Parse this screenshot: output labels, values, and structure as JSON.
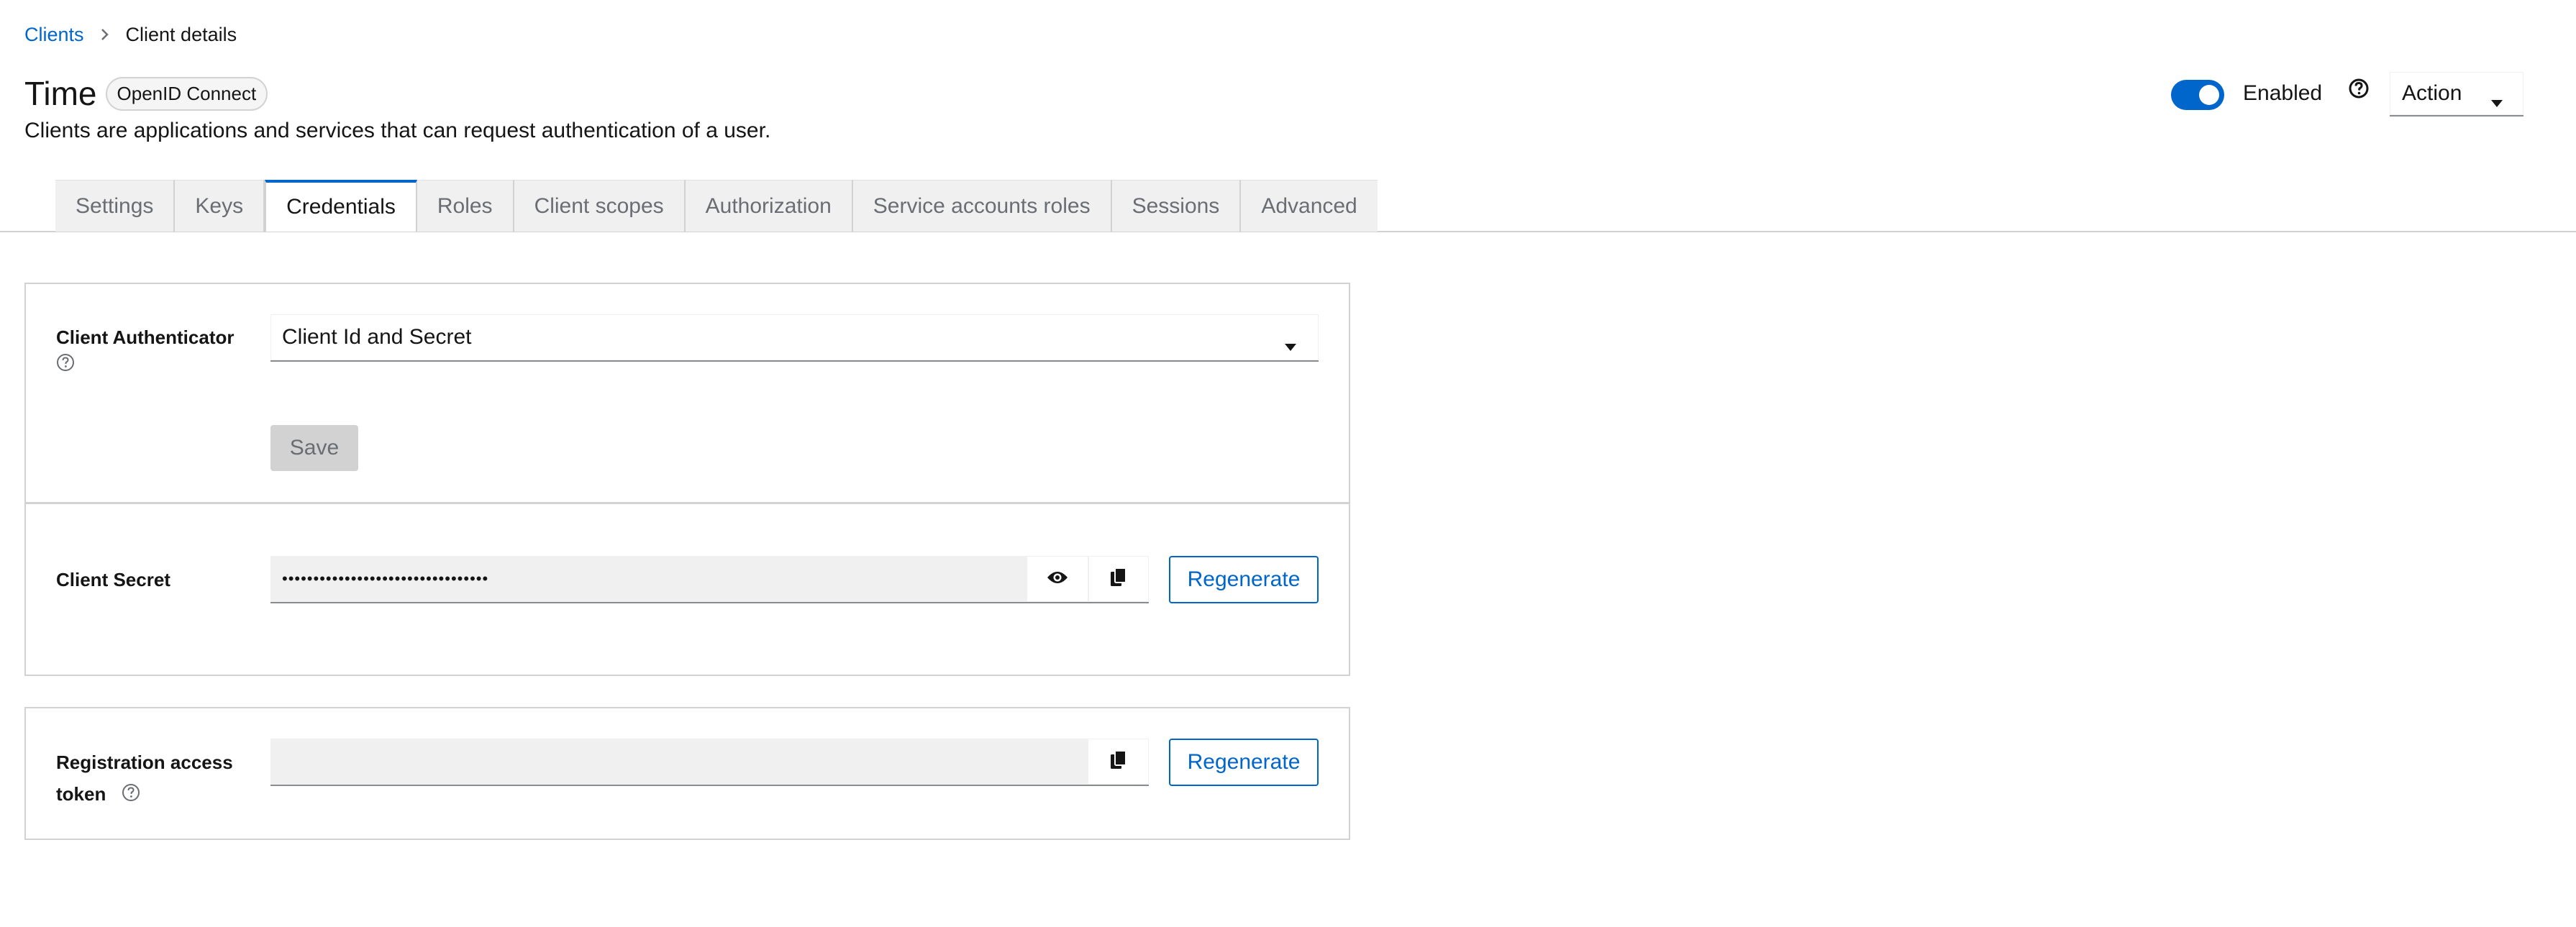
{
  "breadcrumb": {
    "parent": "Clients",
    "current": "Client details"
  },
  "header": {
    "title": "Time",
    "protocol_badge": "OpenID Connect",
    "subtitle": "Clients are applications and services that can request authentication of a user.",
    "enabled_label": "Enabled",
    "enabled": true,
    "action_label": "Action"
  },
  "tabs": [
    {
      "label": "Settings",
      "active": false
    },
    {
      "label": "Keys",
      "active": false
    },
    {
      "label": "Credentials",
      "active": true
    },
    {
      "label": "Roles",
      "active": false
    },
    {
      "label": "Client scopes",
      "active": false
    },
    {
      "label": "Authorization",
      "active": false
    },
    {
      "label": "Service accounts roles",
      "active": false
    },
    {
      "label": "Sessions",
      "active": false
    },
    {
      "label": "Advanced",
      "active": false
    }
  ],
  "authenticator": {
    "label": "Client Authenticator",
    "selected": "Client Id and Secret",
    "save_label": "Save"
  },
  "client_secret": {
    "label": "Client Secret",
    "masked_value": "•••••••••••••••••••••••••••••••••",
    "regenerate_label": "Regenerate"
  },
  "registration_token": {
    "label_line1": "Registration access",
    "label_line2": "token",
    "value": "",
    "regenerate_label": "Regenerate"
  },
  "colors": {
    "accent": "#0066cc",
    "border": "#d2d2d2",
    "input_bg": "#f0f0f0"
  }
}
